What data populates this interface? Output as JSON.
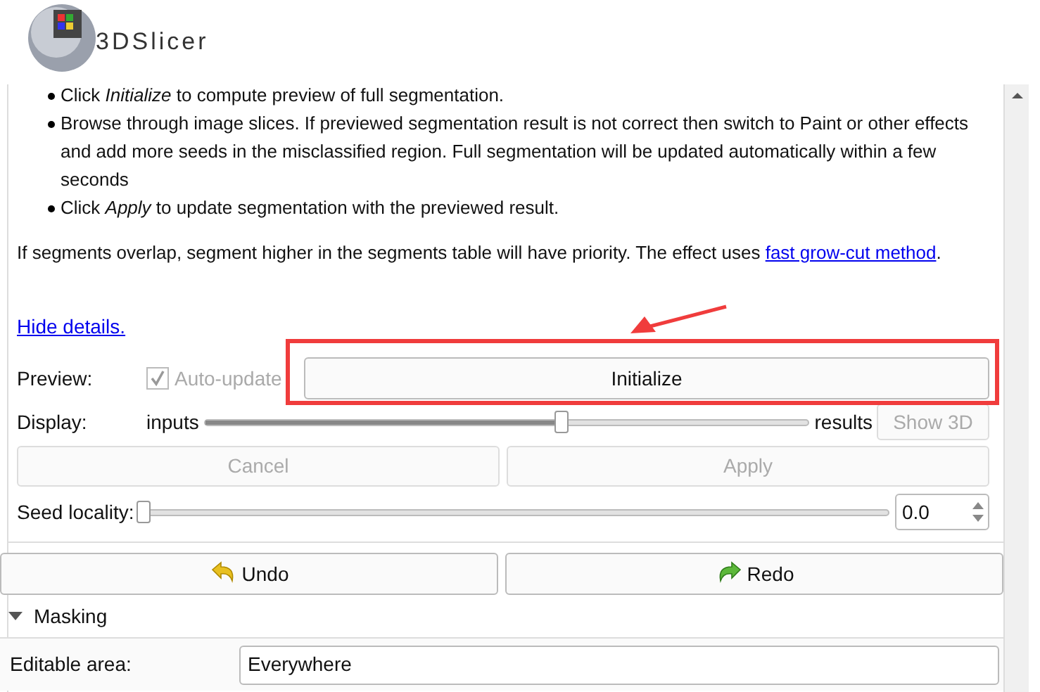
{
  "header": {
    "app_name": "3DSlicer"
  },
  "help": {
    "bullets": [
      "Click *Initialize* to compute preview of full segmentation.",
      "Browse through image slices. If previewed segmentation result is not correct then switch to Paint or other effects and add more seeds in the misclassified region. Full segmentation will be updated automatically within a few seconds",
      "Click *Apply* to update segmentation with the previewed result."
    ],
    "note": {
      "text": "If segments overlap, segment higher in the segments table will have priority. The effect uses ",
      "link": "fast grow-cut method",
      "suffix": "."
    },
    "hide_link": "Hide details."
  },
  "preview": {
    "label": "Preview:",
    "auto_update": {
      "label": "Auto-update",
      "checked": true,
      "disabled": true
    },
    "initialize_button": "Initialize"
  },
  "display": {
    "label": "Display:",
    "left_label": "inputs",
    "right_label": "results",
    "level": 0.59,
    "show_3d": {
      "label": "Show 3D",
      "disabled": true
    }
  },
  "actions": [
    {
      "label": "Cancel",
      "disabled": true
    },
    {
      "label": "Apply",
      "disabled": true
    }
  ],
  "seed_locality": {
    "label": "Seed locality:",
    "level": 0,
    "value": "0.0"
  },
  "history": [
    {
      "kind": "undo",
      "label": "Undo"
    },
    {
      "kind": "redo",
      "label": "Redo"
    }
  ],
  "masking": {
    "title": "Masking",
    "expanded": true,
    "editable_area": {
      "label": "Editable area:",
      "value": "Everywhere"
    }
  }
}
